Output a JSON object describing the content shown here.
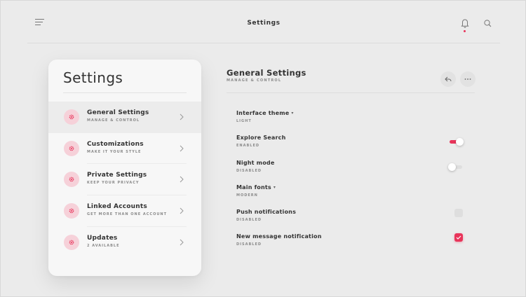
{
  "header": {
    "title": "Settings"
  },
  "sidebar": {
    "title": "Settings",
    "items": [
      {
        "label": "General Settings",
        "sub": "MANAGE & CONTROL",
        "icon": "gear-icon",
        "active": true
      },
      {
        "label": "Customizations",
        "sub": "MAKE IT YOUR STYLE",
        "icon": "gear-icon",
        "active": false
      },
      {
        "label": "Private Settings",
        "sub": "KEEP YOUR PRIVACY",
        "icon": "gear-icon",
        "active": false
      },
      {
        "label": "Linked Accounts",
        "sub": "GET MORE THAN ONE ACCOUNT",
        "icon": "gear-icon",
        "active": false
      },
      {
        "label": "Updates",
        "sub": "2 AVAILABLE",
        "icon": "gear-icon",
        "active": false
      }
    ]
  },
  "panel": {
    "title": "General Settings",
    "subtitle": "MANAGE & CONTROL",
    "settings": [
      {
        "label": "Interface theme",
        "value": "LIGHT",
        "control": "dropdown"
      },
      {
        "label": "Explore Search",
        "value": "ENABLED",
        "control": "toggle",
        "state": true
      },
      {
        "label": "Night mode",
        "value": "DISABLED",
        "control": "toggle",
        "state": false
      },
      {
        "label": "Main fonts",
        "value": "MODERN",
        "control": "dropdown"
      },
      {
        "label": "Push notifications",
        "value": "DISABLED",
        "control": "checkbox",
        "state": false
      },
      {
        "label": "New message notification",
        "value": "DISABLED",
        "control": "checkbox",
        "state": true
      }
    ]
  },
  "colors": {
    "background": "#ebebeb",
    "card": "#f7f7f7",
    "accent": "#e8345a",
    "accent_light": "#f6d1d9"
  }
}
